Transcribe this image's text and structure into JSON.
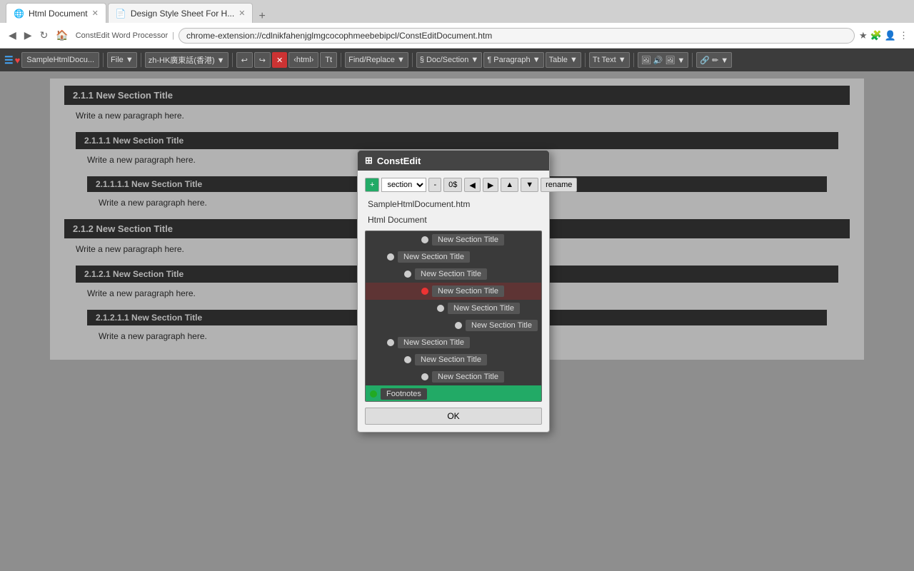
{
  "browser": {
    "tabs": [
      {
        "label": "Html Document",
        "active": true
      },
      {
        "label": "Design Style Sheet For H...",
        "active": false
      }
    ],
    "address": "chrome-extension://cdlnikfahenjglmgcocophmeebebipcl/ConstEditDocument.htm",
    "app_name": "ConstEdit Word Processor"
  },
  "toolbar": {
    "logo": "☰",
    "heart": "♥",
    "doc_name": "SampleHtmlDocu...",
    "file_menu": "File ▼",
    "lang": "zh-HK廣東話(香港) ▼",
    "circle_green": "●",
    "html_btn": "‹html›",
    "tt_btn": "Tt",
    "find_replace": "Find/Replace ▼",
    "doc_section": "§ Doc/Section ▼",
    "paragraph": "¶ Paragraph ▼",
    "table": "Table ▼",
    "tt_text": "Tt Text ▼",
    "media_icons": "🖼 🔊 🖼 ▼",
    "link_icons": "🔗 ✏ ▼"
  },
  "document": {
    "sections": [
      {
        "id": "2.1.1",
        "title": "2.1.1 New Section Title",
        "content": "Write a new paragraph here.",
        "subsections": [
          {
            "id": "2.1.1.1",
            "title": "2.1.1.1 New Section Title",
            "content": "Write a new paragraph here.",
            "subsections": [
              {
                "id": "2.1.1.1.1",
                "title": "2.1.1.1.1 New Section Title",
                "content": "Write a new paragraph here."
              }
            ]
          }
        ]
      },
      {
        "id": "2.1.2",
        "title": "2.1.2 New Section Title",
        "content": "Write a new paragraph here.",
        "subsections": [
          {
            "id": "2.1.2.1",
            "title": "2.1.2.1 New Section Title",
            "content": "Write a new paragraph here.",
            "subsections": [
              {
                "id": "2.1.2.1.1",
                "title": "2.1.2.1.1 New Section Title",
                "content": "Write a new paragraph here."
              }
            ]
          }
        ]
      }
    ]
  },
  "dialog": {
    "title": "ConstEdit",
    "icon": "⊞",
    "toolbar": {
      "add_btn": "+",
      "type_select": "section",
      "remove_btn": "-",
      "ds_btn": "0$",
      "left_btn": "◀",
      "right_btn": "▶",
      "up_btn": "▲",
      "down_btn": "▼",
      "rename_btn": "rename"
    },
    "filename": "SampleHtmlDocument.htm",
    "docname": "Html Document",
    "tree_items": [
      {
        "indent": 3,
        "label": "New Section Title",
        "radio": "filled",
        "level": 0
      },
      {
        "indent": 1,
        "label": "New Section Title",
        "radio": "filled",
        "level": 1
      },
      {
        "indent": 2,
        "label": "New Section Title",
        "radio": "filled",
        "level": 2
      },
      {
        "indent": 3,
        "label": "New Section Title",
        "radio": "red",
        "level": 3,
        "active": true
      },
      {
        "indent": 4,
        "label": "New Section Title",
        "radio": "filled",
        "level": 4
      },
      {
        "indent": 5,
        "label": "New Section Title",
        "radio": "filled",
        "level": 5
      },
      {
        "indent": 1,
        "label": "New Section Title",
        "radio": "filled",
        "level": 1
      },
      {
        "indent": 2,
        "label": "New Section Title",
        "radio": "filled",
        "level": 2
      },
      {
        "indent": 3,
        "label": "New Section Title",
        "radio": "filled",
        "level": 3
      },
      {
        "indent": 0,
        "label": "Footnotes",
        "radio": "green",
        "level": 0,
        "green": true
      }
    ],
    "ok_btn": "OK"
  }
}
